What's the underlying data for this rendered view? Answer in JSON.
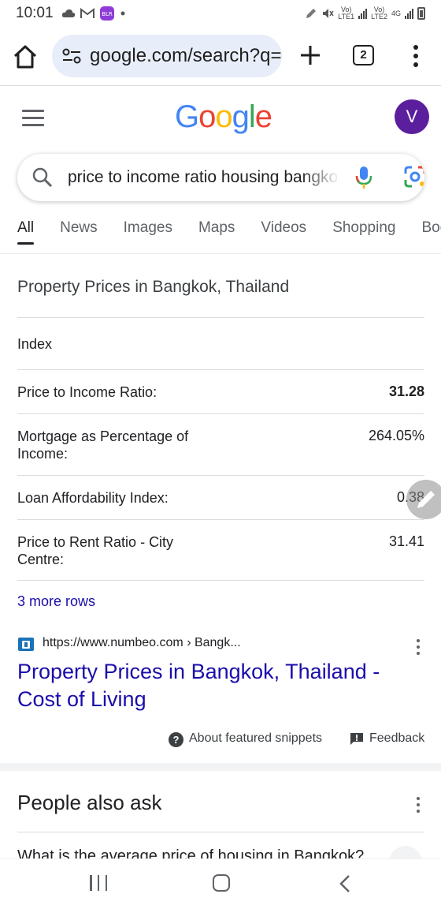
{
  "status_bar": {
    "time": "10:01",
    "sim1": "LTE1",
    "sim2": "LTE2",
    "network": "4G"
  },
  "browser": {
    "url": "google.com/search?q=",
    "tab_count": "2",
    "icons": [
      "home-icon",
      "site-settings-icon",
      "new-tab-icon",
      "tab-switcher-icon",
      "overflow-menu-icon"
    ]
  },
  "header": {
    "logo_letters": [
      "G",
      "o",
      "o",
      "g",
      "l",
      "e"
    ],
    "avatar_letter": "V"
  },
  "search": {
    "query": "price to income ratio housing bangkok",
    "icons": [
      "search-icon",
      "mic-icon",
      "lens-icon"
    ]
  },
  "tabs": [
    "All",
    "News",
    "Images",
    "Maps",
    "Videos",
    "Shopping",
    "Books"
  ],
  "snippet": {
    "title": "Property Prices in Bangkok, Thailand",
    "header": "Index",
    "rows": [
      {
        "label": "Price to Income Ratio:",
        "value": "31.28"
      },
      {
        "label": "Mortgage as Percentage of Income:",
        "value": "264.05%"
      },
      {
        "label": "Loan Affordability Index:",
        "value": "0.38"
      },
      {
        "label": "Price to Rent Ratio - City Centre:",
        "value": "31.41"
      }
    ],
    "more_rows": "3 more rows"
  },
  "source": {
    "url": "https://www.numbeo.com › Bangk...",
    "title": "Property Prices in Bangkok, Thailand - Cost of Living"
  },
  "footer": {
    "about": "About featured snippets",
    "feedback": "Feedback"
  },
  "people_also_ask": {
    "title": "People also ask",
    "first_question": "What is the average price of housing in Bangkok?"
  }
}
